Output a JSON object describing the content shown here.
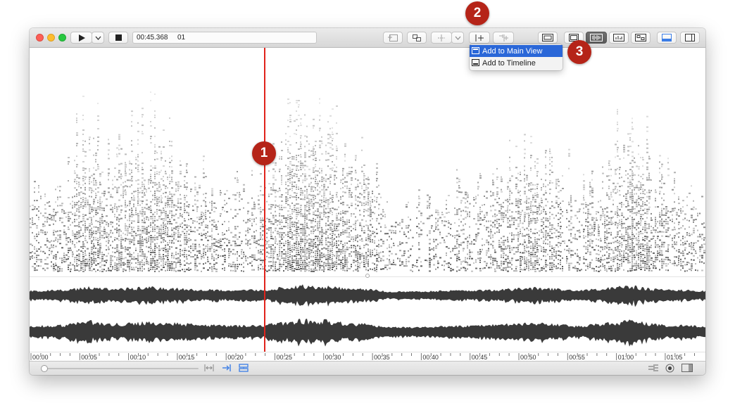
{
  "toolbar": {
    "time": "00:45.368",
    "marker": "01"
  },
  "menu": {
    "items": [
      {
        "label": "Add to Main View",
        "selected": true
      },
      {
        "label": "Add to Timeline",
        "selected": false
      }
    ]
  },
  "callouts": [
    "1",
    "2",
    "3"
  ],
  "timeline": {
    "labels": [
      "00:00",
      "00:05",
      "00:10",
      "00:15",
      "00:20",
      "00:25",
      "00:30",
      "00:35",
      "00:40",
      "00:45",
      "00:50",
      "00:55",
      "01:00",
      "01:05"
    ]
  },
  "colors": {
    "playhead": "#e0231b",
    "selection": "#2a67d8",
    "callout": "#b52418",
    "waveform": "#3a3a3a",
    "accent": "#3b7de6"
  },
  "icons": {
    "play": "play-icon",
    "dropdown": "chevron-down-icon",
    "stop": "stop-icon",
    "main-view": "main-view-icon",
    "timeline": "timeline-icon"
  }
}
